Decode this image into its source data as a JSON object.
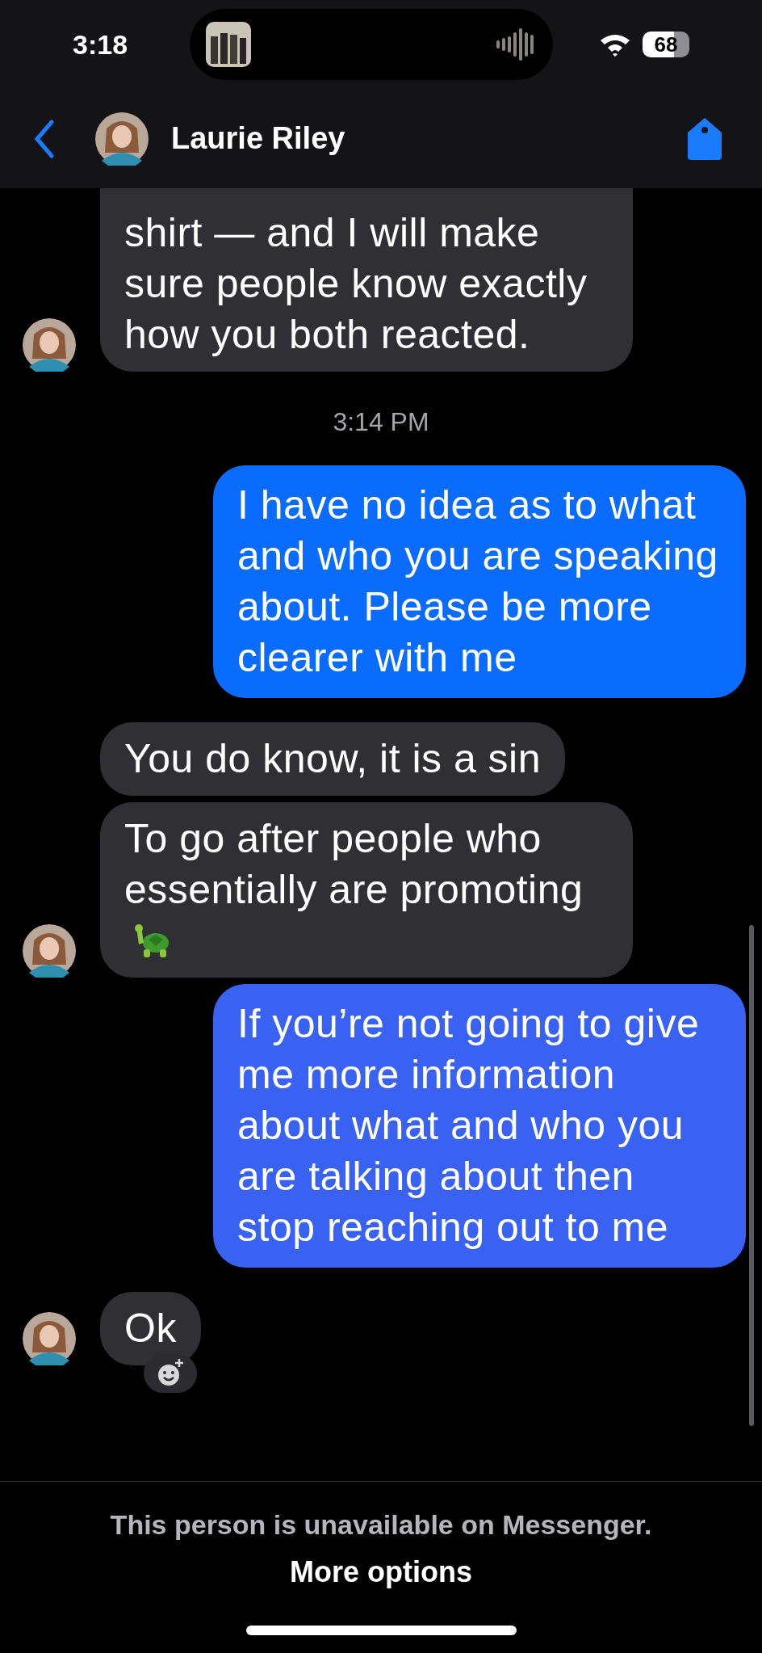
{
  "status_bar": {
    "time": "3:18",
    "battery": "68"
  },
  "header": {
    "name": "Laurie Riley"
  },
  "messages": [
    {
      "kind": "incoming",
      "text": "shirt — and I will make sure people know exactly how you both reacted.",
      "cut_top": true,
      "avatar": true
    },
    {
      "kind": "timestamp",
      "text": "3:14 PM"
    },
    {
      "kind": "outgoing",
      "text": "I have no idea as to what and who you are speaking about. Please be more clearer with me",
      "color": "#0a6cff"
    },
    {
      "kind": "incoming",
      "text": "You do know, it is a sin",
      "avatar": false
    },
    {
      "kind": "incoming",
      "text": "To go after people who essentially are promoting",
      "trailing_icon": true,
      "avatar": true
    },
    {
      "kind": "outgoing",
      "text": "If you’re not going to give me more information about what and who you are talking about then stop reaching out to me",
      "color": "#3a62f2"
    },
    {
      "kind": "incoming",
      "text": "Ok",
      "avatar": true,
      "react": true
    }
  ],
  "footer": {
    "notice": "This person is unavailable on Messenger.",
    "link": "More options"
  }
}
